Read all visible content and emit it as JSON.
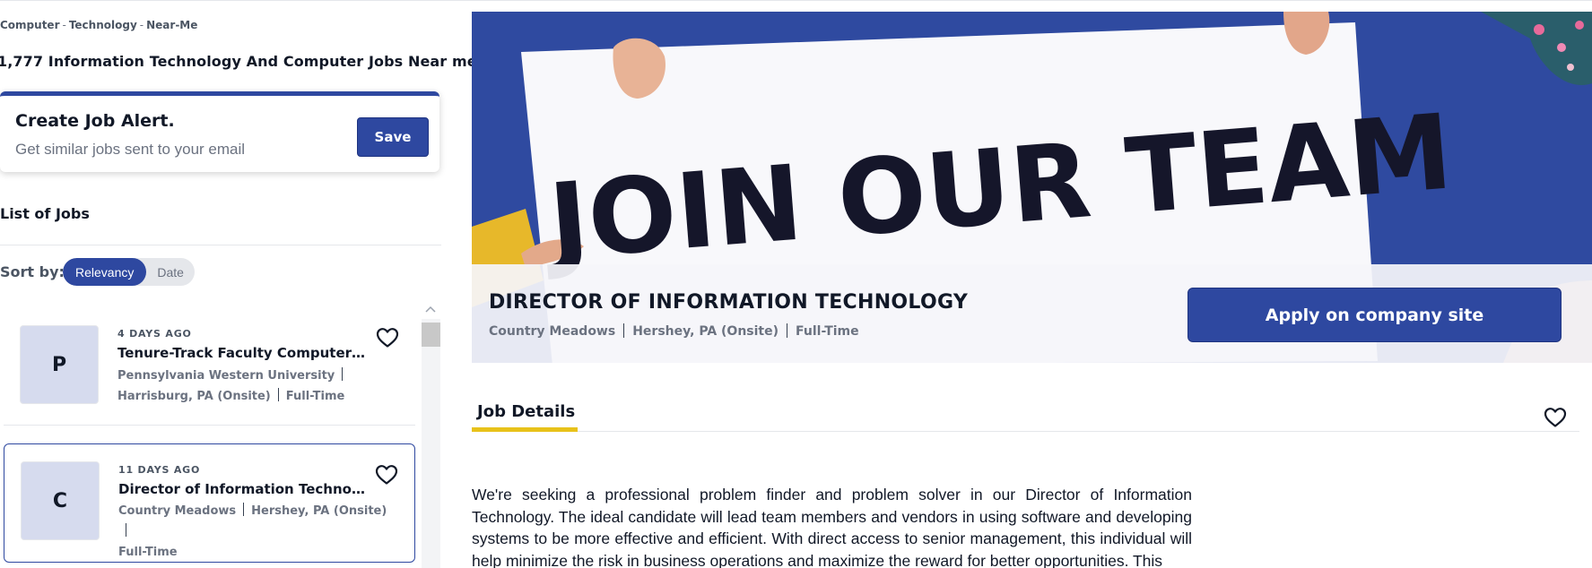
{
  "breadcrumb": [
    "Computer",
    "Technology",
    "Near-Me"
  ],
  "breadcrumb_sep": "-",
  "results_heading": "1,777 Information Technology And Computer Jobs Near me",
  "job_alert": {
    "title": "Create Job Alert.",
    "subtitle": "Get similar jobs sent to your email",
    "save_label": "Save"
  },
  "list_title": "List of Jobs",
  "sort": {
    "label": "Sort by:",
    "options": [
      "Relevancy",
      "Date"
    ],
    "selected": "Relevancy"
  },
  "jobs": [
    {
      "logo_letter": "P",
      "age": "4 DAYS AGO",
      "title": "Tenure-Track Faculty Computer-...",
      "company": "Pennsylvania Western University",
      "location": "Harrisburg, PA (Onsite)",
      "type": "Full-Time"
    },
    {
      "logo_letter": "C",
      "age": "11 DAYS AGO",
      "title": "Director of Information Technology",
      "company": "Country Meadows",
      "location": "Hershey, PA (Onsite)",
      "type": "Full-Time"
    }
  ],
  "detail": {
    "hero_text": "JOIN OUR TEAM",
    "title": "DIRECTOR OF INFORMATION TECHNOLOGY",
    "company": "Country Meadows",
    "location": "Hershey, PA (Onsite)",
    "type": "Full-Time",
    "apply_label": "Apply on company site",
    "tab_label": "Job Details",
    "description": "We're seeking a professional problem finder and problem solver in our Director of Information Technology. The ideal candidate will lead team members and vendors in using software and developing systems to be more effective and efficient. With direct access to senior management, this individual will help minimize the risk in business operations and maximize the reward for better opportunities. This"
  },
  "colors": {
    "brand": "#2e48a0",
    "tab_underline": "#e8c21a",
    "logo_bg": "#d6dbee"
  },
  "icons": [
    "heart-icon",
    "scroll-up-arrow-icon"
  ]
}
